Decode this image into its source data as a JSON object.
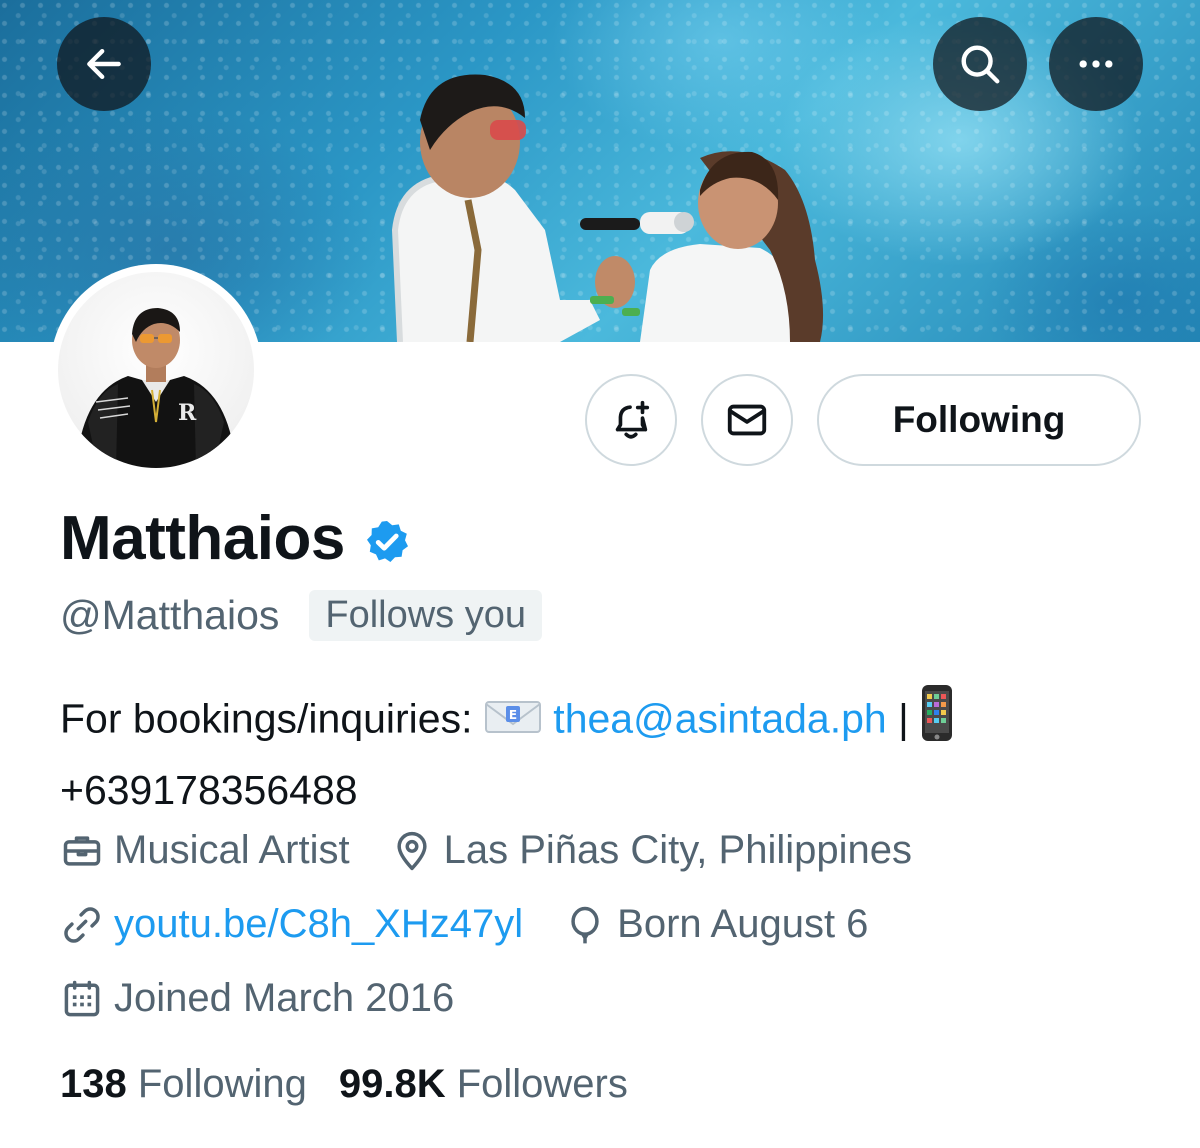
{
  "header": {
    "back_icon": "arrow-left-icon",
    "search_icon": "search-icon",
    "more_icon": "more-horizontal-icon"
  },
  "actions": {
    "notify_icon": "bell-plus-icon",
    "message_icon": "envelope-icon",
    "following_label": "Following"
  },
  "profile": {
    "display_name": "Matthaios",
    "verified": true,
    "handle": "@Matthaios",
    "follows_you": "Follows you",
    "bio": {
      "prefix": "For bookings/inquiries:",
      "email_emoji": "e-mail-emoji",
      "email": "thea@asintada.ph",
      "separator": "|",
      "phone_emoji": "mobile-phone-emoji",
      "phone": "+639178356488"
    },
    "category": "Musical Artist",
    "location": "Las Piñas City, Philippines",
    "website": "youtu.be/C8h_XHz47yl",
    "birthday": "Born August 6",
    "joined": "Joined March 2016"
  },
  "stats": {
    "following_count": "138",
    "following_label": "Following",
    "followers_count": "99.8K",
    "followers_label": "Followers"
  },
  "colors": {
    "accent": "#1d9bf0",
    "secondary_text": "#536471",
    "primary_text": "#0f1419",
    "border": "#cfd9de"
  }
}
